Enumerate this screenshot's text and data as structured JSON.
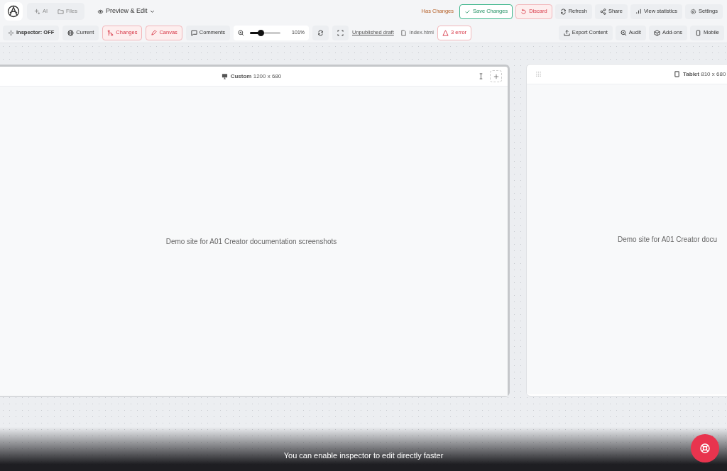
{
  "topbar": {
    "tabs": [
      {
        "label": "AI",
        "selected": false
      },
      {
        "label": "Files",
        "selected": false
      }
    ],
    "mode": {
      "label": "Preview & Edit"
    },
    "status": "Has Changes",
    "actions": [
      {
        "label": "Save Changes",
        "kind": "success"
      },
      {
        "label": "Discard",
        "kind": "danger"
      },
      {
        "label": "Refresh",
        "kind": "plain"
      },
      {
        "label": "Share",
        "kind": "plain"
      },
      {
        "label": "View statistics",
        "kind": "plain"
      },
      {
        "label": "Settings",
        "kind": "plain"
      }
    ]
  },
  "toolbar": {
    "left": [
      {
        "label": "Inspector: OFF",
        "kind": "plain"
      },
      {
        "label": "Current",
        "kind": "plain"
      },
      {
        "label": "Changes",
        "kind": "danger"
      },
      {
        "label": "Canvas",
        "kind": "danger"
      },
      {
        "label": "Comments",
        "kind": "plain"
      }
    ],
    "zoom": {
      "level": 0.35,
      "reading": "101%"
    },
    "draft_link": "Unpublished draft",
    "file": "index.html",
    "errors": "3 error",
    "right": [
      {
        "label": "Export Content"
      },
      {
        "label": "Audit"
      },
      {
        "label": "Add-ons"
      },
      {
        "label": "Mobile"
      }
    ]
  },
  "frames": [
    {
      "device": "Custom",
      "size": "1200 x 680",
      "content": "Demo site for A01 Creator documentation screenshots",
      "selected": true
    },
    {
      "device": "Tablet",
      "size": "810 x 680",
      "content": "Demo site for A01 Creator docu",
      "selected": false
    }
  ],
  "toast": "You can enable inspector to edit directly faster"
}
